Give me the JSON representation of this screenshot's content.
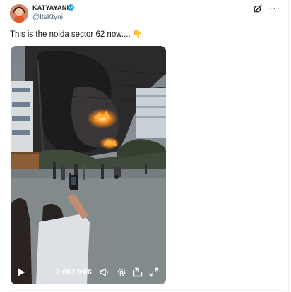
{
  "post": {
    "author_name": "KATYAYANI",
    "author_handle": "@ItsKtyni",
    "text": "This is the noida sector 62 now.... 👇"
  },
  "video": {
    "current_time": "0:00",
    "separator": " / ",
    "duration": "0:06",
    "progress": 0
  },
  "icons": {
    "header": [
      "verified-badge-icon",
      "grok-icon",
      "more-options-icon"
    ],
    "player": [
      "play-icon",
      "volume-icon",
      "settings-icon",
      "picture-in-picture-icon",
      "fullscreen-icon"
    ]
  },
  "colors": {
    "verified_blue": "#1d9bf0",
    "text_primary": "#0f1419",
    "text_secondary": "#536471",
    "fire": "#ff8a1c"
  }
}
